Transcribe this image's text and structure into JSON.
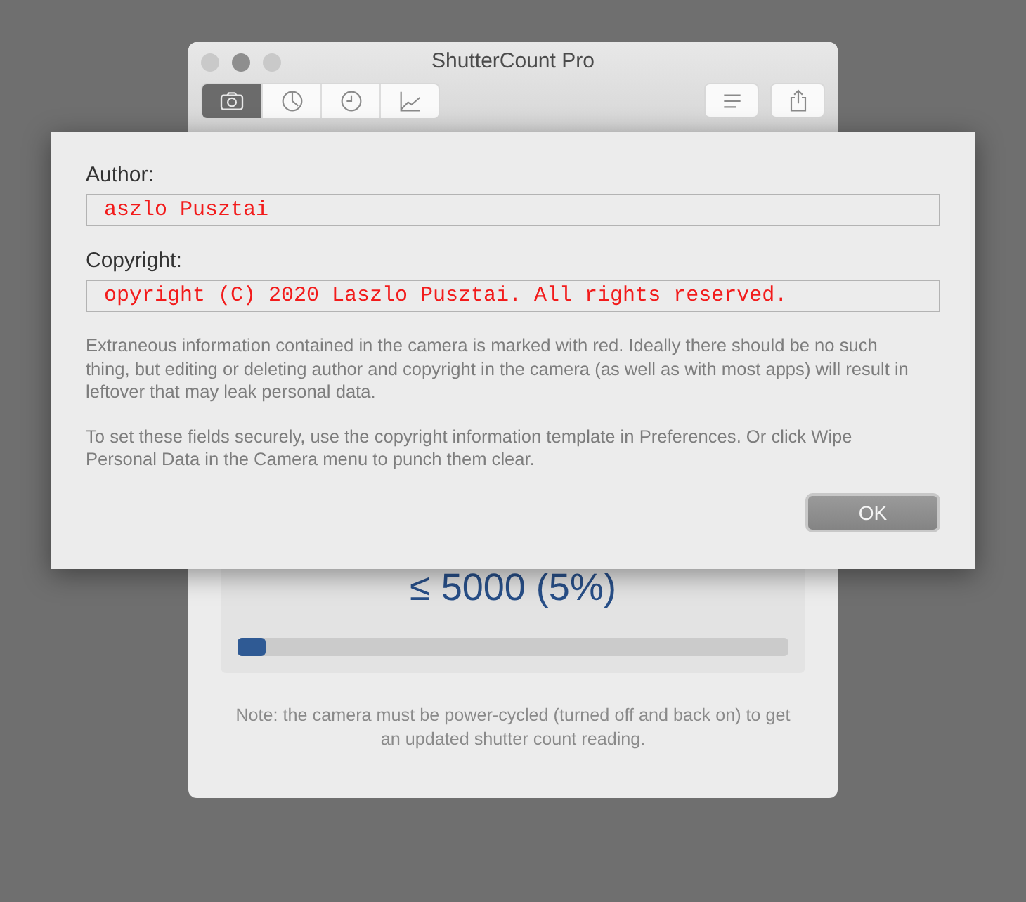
{
  "window": {
    "title": "ShutterCount Pro"
  },
  "tabs": [
    {
      "kind": "camera",
      "selected": true
    },
    {
      "kind": "gauge",
      "selected": false
    },
    {
      "kind": "clock",
      "selected": false
    },
    {
      "kind": "chart",
      "selected": false
    }
  ],
  "toolbar_buttons": [
    {
      "kind": "list"
    },
    {
      "kind": "share"
    }
  ],
  "count": {
    "reading": "≤ 5000 (5%)",
    "level": 0.05
  },
  "note": "Note: the camera must be power-cycled (turned off and back on) to get an updated shutter count reading.",
  "sheet": {
    "fields": [
      {
        "label": "Author:",
        "value": "aszlo Pusztai"
      },
      {
        "label": "Copyright:",
        "value": "opyright (C) 2020 Laszlo Pusztai. All rights reserved."
      }
    ],
    "paragraphs": [
      "Extraneous information contained in the camera is marked with red. Ideally there should be no such thing, but editing or deleting author and copyright in the camera (as well as with most apps) will result in leftover that may leak personal data.",
      "To set these fields securely, use the copyright information template in Preferences. Or click Wipe Personal Data in the Camera menu to punch them clear."
    ],
    "button": "OK"
  }
}
